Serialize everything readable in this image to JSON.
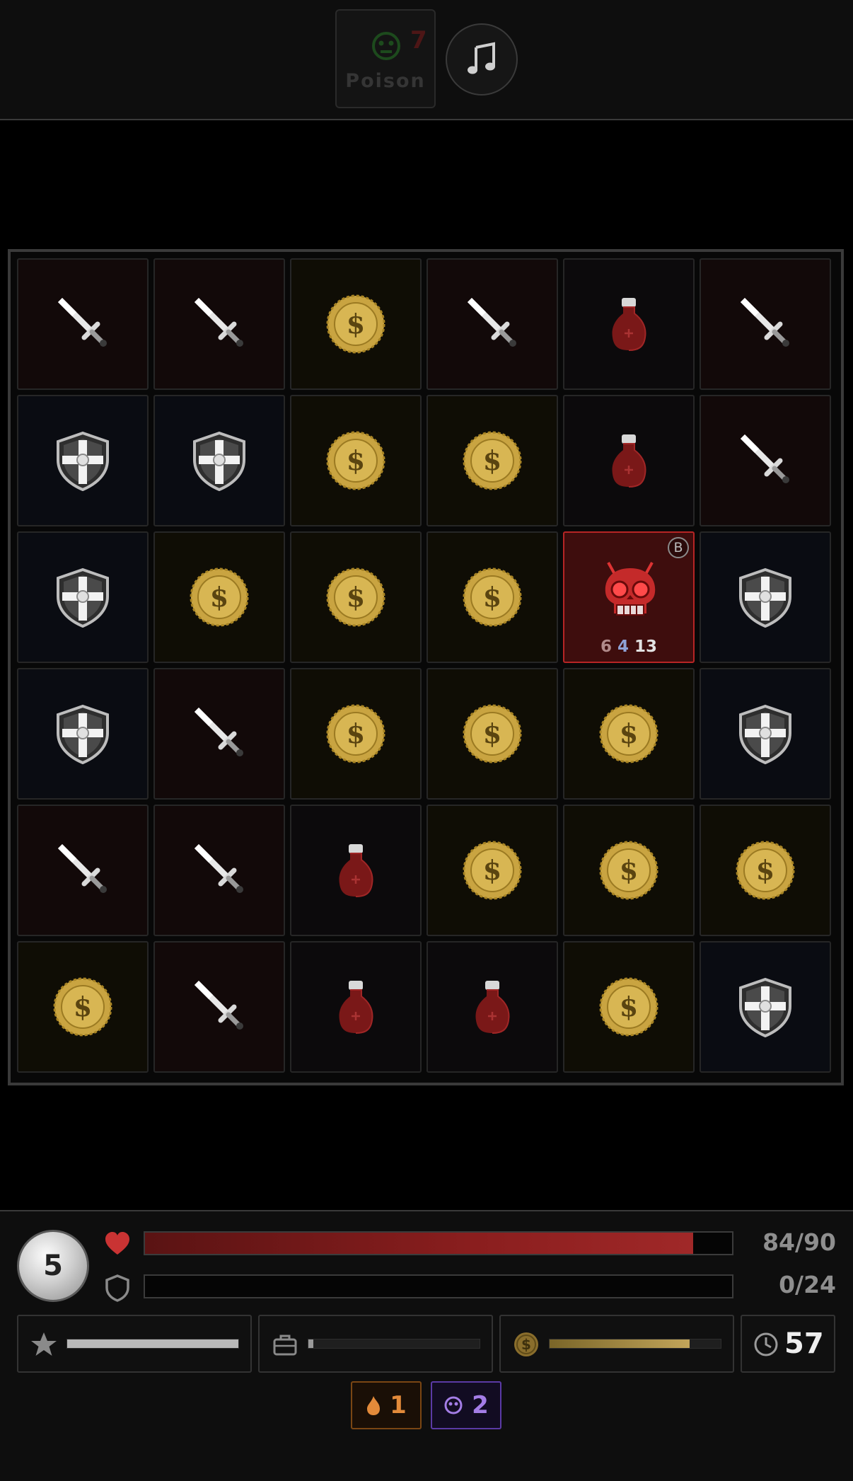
{
  "top_bar": {
    "poison": {
      "label": "Poison",
      "count": "7",
      "icon": "poison-face-icon"
    },
    "music": {
      "icon": "music-note-icon"
    }
  },
  "board": {
    "rows": 6,
    "cols": 6,
    "tiles": [
      [
        "sword",
        "sword",
        "coin",
        "sword",
        "potion",
        "sword"
      ],
      [
        "shield",
        "shield",
        "coin",
        "coin",
        "potion",
        "sword"
      ],
      [
        "shield",
        "coin",
        "coin",
        "coin",
        "enemy",
        "shield"
      ],
      [
        "shield",
        "sword",
        "coin",
        "coin",
        "coin",
        "shield"
      ],
      [
        "sword",
        "sword",
        "potion",
        "coin",
        "coin",
        "coin"
      ],
      [
        "coin",
        "sword",
        "potion",
        "potion",
        "coin",
        "shield"
      ]
    ],
    "enemy": {
      "badge": "B",
      "stats": [
        "6",
        "4",
        "13"
      ],
      "stat_colors": [
        "#b08a8a",
        "#8fa2d6",
        "#e2e2e2"
      ]
    }
  },
  "hud": {
    "level": "5",
    "hp": {
      "text": "84/90",
      "current": 84,
      "max": 90
    },
    "armor": {
      "text": "0/24",
      "current": 0,
      "max": 24
    },
    "xp": {
      "icon": "star-icon",
      "fill": 1.0
    },
    "inventory": {
      "icon": "briefcase-icon",
      "fill": 0.03
    },
    "gold": {
      "icon": "coin-icon",
      "fill": 0.82
    },
    "timer": {
      "icon": "clock-icon",
      "value": "57"
    },
    "effects": [
      {
        "name": "fire",
        "icon": "flame-icon",
        "count": "1",
        "color": "#e28a3a"
      },
      {
        "name": "mask",
        "icon": "mask-icon",
        "count": "2",
        "color": "#a47de6"
      }
    ]
  }
}
